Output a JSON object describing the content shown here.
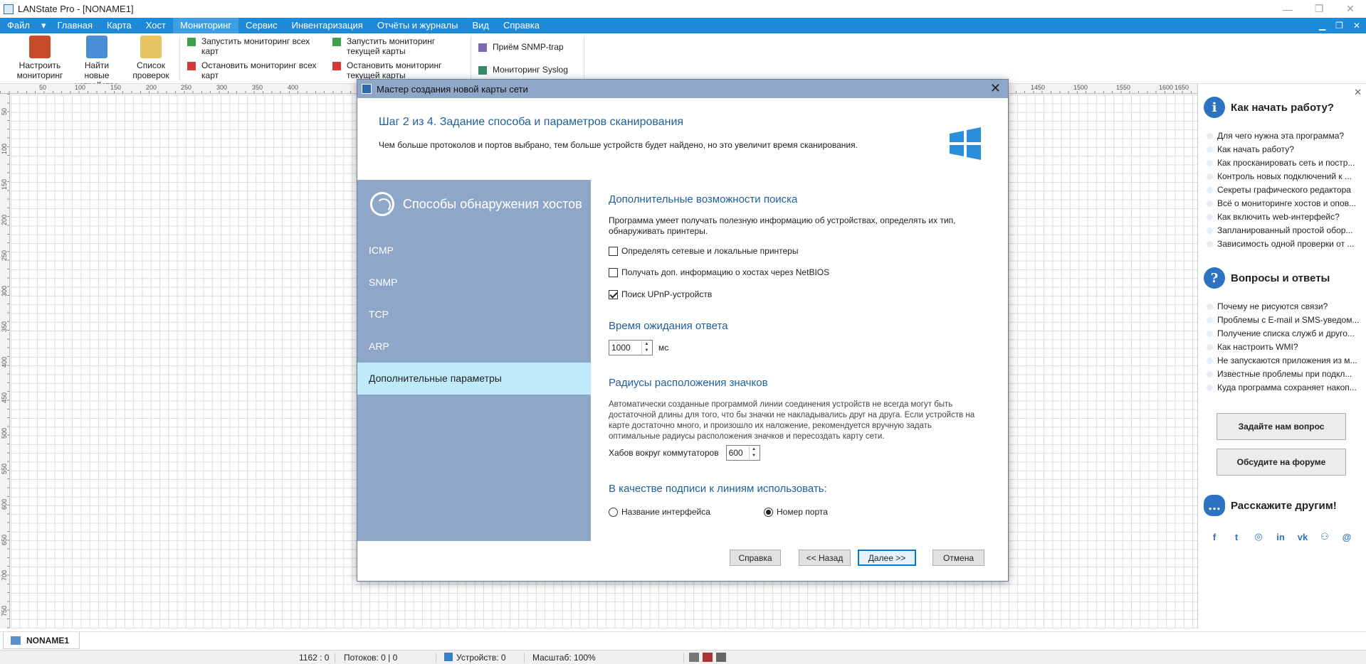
{
  "window": {
    "title": "LANState Pro - [NONAME1]"
  },
  "menu": {
    "file": "Файл",
    "items": [
      "Главная",
      "Карта",
      "Хост",
      "Мониторинг",
      "Сервис",
      "Инвентаризация",
      "Отчёты и журналы",
      "Вид",
      "Справка"
    ],
    "active_index": 3
  },
  "ribbon": {
    "configure": "Настроить мониторинг",
    "find_new": "Найти новые устройства",
    "checks": "Список проверок",
    "start_all": "Запустить мониторинг всех карт",
    "stop_all": "Остановить мониторинг всех карт",
    "start_current": "Запустить мониторинг текущей карты",
    "stop_current": "Остановить мониторинг текущей карты",
    "snmp_trap": "Приём SNMP-trap",
    "syslog": "Мониторинг Syslog"
  },
  "ruler": {
    "top": [
      "50",
      "100",
      "150",
      "200",
      "250",
      "300",
      "350",
      "400",
      "1450",
      "1500",
      "1550",
      "1600",
      "1650"
    ],
    "left": [
      "50",
      "100",
      "150",
      "200",
      "250",
      "300",
      "350",
      "400",
      "450",
      "500",
      "550",
      "600",
      "650",
      "700",
      "750"
    ]
  },
  "dialog": {
    "title": "Мастер создания новой карты сети",
    "step_title": "Шаг 2 из 4. Задание способа и параметров сканирования",
    "step_desc": "Чем больше протоколов и портов выбрано, тем больше устройств будет найдено, но это увеличит время сканирования.",
    "nav_header": "Способы обнаружения хостов",
    "nav": [
      "ICMP",
      "SNMP",
      "TCP",
      "ARP",
      "Дополнительные параметры"
    ],
    "nav_selected": 4,
    "sec_search": "Дополнительные возможности поиска",
    "search_desc": "Программа умеет получать полезную информацию об устройствах, определять их тип, обнаруживать принтеры.",
    "checkboxes": [
      {
        "label": "Определять сетевые и локальные принтеры",
        "checked": false
      },
      {
        "label": "Получать доп. информацию о хостах через NetBIOS",
        "checked": false
      },
      {
        "label": "Поиск UPnP-устройств",
        "checked": true
      }
    ],
    "sec_timeout": "Время ожидания ответа",
    "timeout_value": "1000",
    "timeout_unit": "мс",
    "sec_radius": "Радиусы расположения значков",
    "radius_desc": "Автоматически созданные программой линии соединения устройств не всегда могут быть достаточной длины для того, что бы значки не накладывались друг на друга. Если устройств на карте достаточно много, и произошло их наложение, рекомендуется вручную задать оптимальные радиусы расположения значков и пересоздать карту сети.",
    "hubs_label": "Хабов вокруг коммутаторов",
    "hubs_value": "600",
    "sec_caption": "В качестве подписи к линиям использовать:",
    "radio_iface": "Название интерфейса",
    "radio_port": "Номер порта",
    "radio_selected": "port",
    "buttons": {
      "help": "Справка",
      "back": "<< Назад",
      "next": "Далее >>",
      "cancel": "Отмена"
    }
  },
  "right_panel": {
    "howto_title": "Как начать работу?",
    "howto_items": [
      "Для чего нужна эта программа?",
      "Как начать работу?",
      "Как просканировать сеть и постр...",
      "Контроль новых подключений к ...",
      "Секреты графического редактора",
      "Всё о мониторинге хостов и опов...",
      "Как включить web-интерфейс?",
      "Запланированный простой обор...",
      "Зависимость одной проверки от ..."
    ],
    "faq_title": "Вопросы и ответы",
    "faq_items": [
      "Почему не рисуются связи?",
      "Проблемы с E-mail и SMS-уведом...",
      "Получение списка служб и друго...",
      "Как настроить WMI?",
      "Не запускаются приложения из м...",
      "Известные проблемы при подкл...",
      "Куда программа сохраняет накоп..."
    ],
    "ask_button": "Задайте нам вопрос",
    "forum_button": "Обсудите на форуме",
    "share_title": "Расскажите другим!",
    "social_icons": [
      "f",
      "t",
      "◎",
      "in",
      "vk",
      "⚇",
      "@"
    ]
  },
  "tabs": {
    "doc": "NONAME1"
  },
  "status": {
    "coords": "1162 : 0",
    "flows": "Потоков: 0 | 0",
    "devices": "Устройств: 0",
    "zoom": "Масштаб: 100%"
  },
  "colors": {
    "menubar": "#1e89d6",
    "nav": "#8ea6c8",
    "nav_selected": "#bfeafb",
    "title_accent": "#1e5f9c"
  }
}
